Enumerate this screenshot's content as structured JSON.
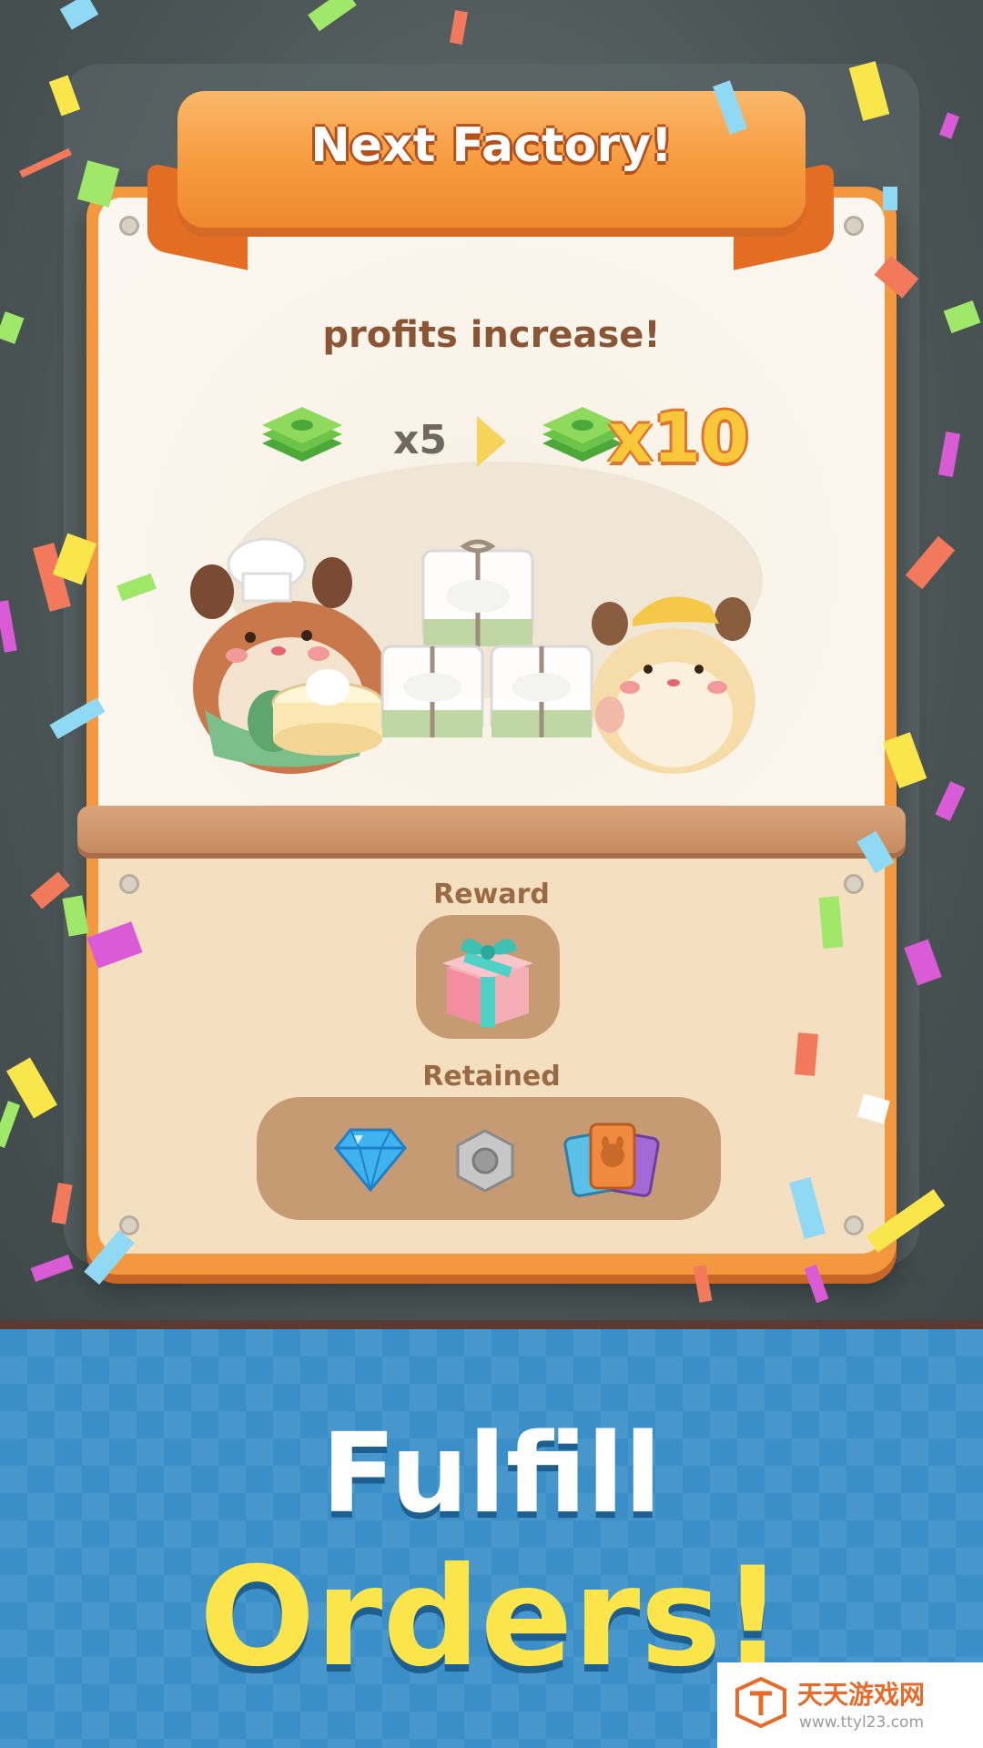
{
  "dialog": {
    "title": "Next Factory!",
    "subtitle": "profits increase!",
    "profit": {
      "current_multiplier": "x5",
      "next_multiplier": "x10"
    },
    "reward_label": "Reward",
    "retained_label": "Retained",
    "reward_icon": "gift-box-icon",
    "retained_items": [
      "diamond-icon",
      "hex-nut-icon",
      "card-deck-icon"
    ]
  },
  "promo": {
    "line1": "Fulfill",
    "line2": "Orders!"
  },
  "watermark": {
    "site_name": "天天游戏网",
    "url": "www.ttyl23.com"
  },
  "colors": {
    "panel_orange": "#f49840",
    "ribbon_orange": "#f69a3e",
    "promo_blue": "#3b8fc9",
    "promo_yellow": "#fbe54b",
    "label_brown": "#9a6a45"
  }
}
